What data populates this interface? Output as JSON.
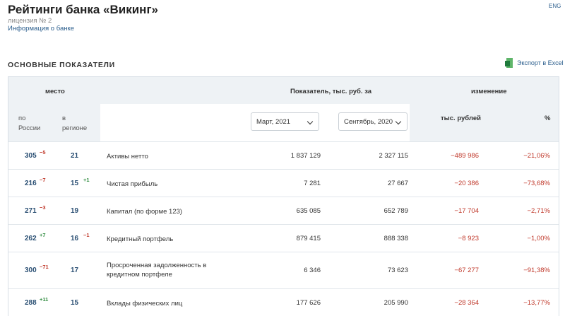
{
  "header": {
    "title": "Рейтинги банка «Викинг»",
    "license": "лицензия № 2",
    "info_link": "Информация о банке",
    "lang": "ENG"
  },
  "section": {
    "title": "ОСНОВНЫЕ ПОКАЗАТЕЛИ",
    "export_label": "Экспорт в Excel"
  },
  "table": {
    "col_place": "место",
    "col_russia": "по\nРоссии",
    "col_region": "в\nрегионе",
    "col_indicator": "Показатель, тыс. руб. за",
    "col_change": "изменение",
    "col_change_abs": "тыс. рублей",
    "col_change_pct": "%",
    "period1": "Март, 2021",
    "period2": "Сентябрь, 2020",
    "rows": [
      {
        "rus": "305",
        "rus_delta": "−5",
        "rus_dir": "neg",
        "reg": "21",
        "reg_delta": "",
        "reg_dir": "",
        "name": "Активы нетто",
        "v1": "1 837 129",
        "v2": "2 327 115",
        "chg": "−489 986",
        "pct": "−21,06%"
      },
      {
        "rus": "216",
        "rus_delta": "−7",
        "rus_dir": "neg",
        "reg": "15",
        "reg_delta": "+1",
        "reg_dir": "pos",
        "name": "Чистая прибыль",
        "v1": "7 281",
        "v2": "27 667",
        "chg": "−20 386",
        "pct": "−73,68%"
      },
      {
        "rus": "271",
        "rus_delta": "−3",
        "rus_dir": "neg",
        "reg": "19",
        "reg_delta": "",
        "reg_dir": "",
        "name": "Капитал (по форме 123)",
        "v1": "635 085",
        "v2": "652 789",
        "chg": "−17 704",
        "pct": "−2,71%"
      },
      {
        "rus": "262",
        "rus_delta": "+7",
        "rus_dir": "pos",
        "reg": "16",
        "reg_delta": "−1",
        "reg_dir": "neg",
        "name": "Кредитный портфель",
        "v1": "879 415",
        "v2": "888 338",
        "chg": "−8 923",
        "pct": "−1,00%"
      },
      {
        "rus": "300",
        "rus_delta": "−71",
        "rus_dir": "neg",
        "reg": "17",
        "reg_delta": "",
        "reg_dir": "",
        "name": "Просроченная задолженность в кредитном портфеле",
        "v1": "6 346",
        "v2": "73 623",
        "chg": "−67 277",
        "pct": "−91,38%"
      },
      {
        "rus": "288",
        "rus_delta": "+11",
        "rus_dir": "pos",
        "reg": "15",
        "reg_delta": "",
        "reg_dir": "",
        "name": "Вклады физических лиц",
        "v1": "177 626",
        "v2": "205 990",
        "chg": "−28 364",
        "pct": "−13,77%"
      }
    ]
  },
  "colors": {
    "accent": "#2a5d8c",
    "negative": "#c0392b",
    "positive": "#2e8b3e",
    "header_bg": "#eef2f5"
  }
}
